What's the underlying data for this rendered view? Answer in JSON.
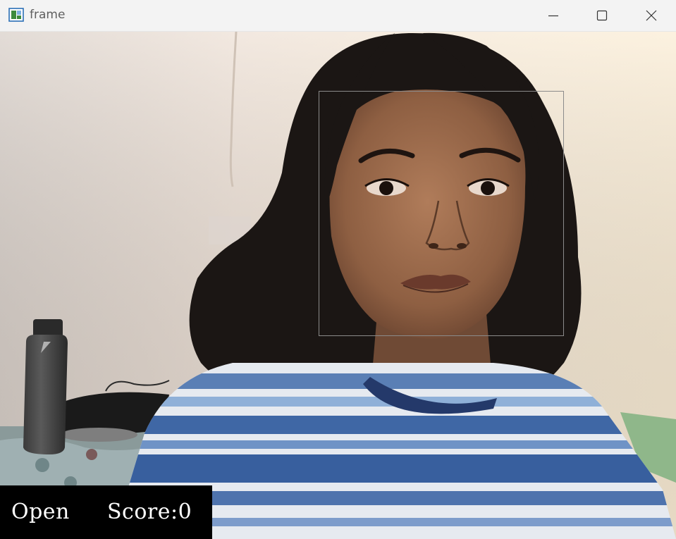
{
  "window": {
    "title": "frame",
    "controls": {
      "minimize": "minimize",
      "maximize": "maximize",
      "close": "close"
    }
  },
  "overlay": {
    "status": "Open",
    "score_label": "Score:0"
  },
  "icons": {
    "app": "opencv-window-icon",
    "minimize": "minimize-icon",
    "maximize": "maximize-icon",
    "close": "close-icon"
  },
  "colors": {
    "titlebar_bg": "#f3f3f3",
    "face_box": "#8b8b8b",
    "overlay_bg": "#000000",
    "overlay_text": "#ffffff"
  }
}
